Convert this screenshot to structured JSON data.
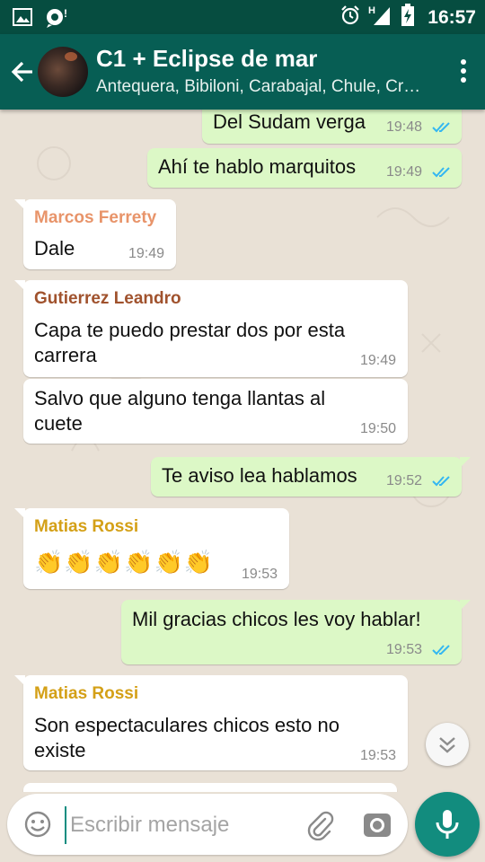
{
  "status_bar": {
    "time": "16:57",
    "icons": [
      "gallery-icon",
      "notification-icon",
      "alarm-icon",
      "signal-icon",
      "battery-charging-icon"
    ],
    "network_label": "H"
  },
  "header": {
    "group_name": "C1 + Eclipse de mar",
    "members": "Antequera, Bibiloni, Carabajal, Chule, Cr…",
    "colors": {
      "header_bg": "#075e54",
      "status_bg": "#064d40"
    }
  },
  "messages": [
    {
      "direction": "out",
      "text": "Del Sudam verga",
      "time": "19:48",
      "status": "read"
    },
    {
      "direction": "out",
      "text": "Ahí te hablo marquitos",
      "time": "19:49",
      "status": "read"
    },
    {
      "direction": "in",
      "sender": "Marcos Ferrety",
      "sender_color": "#e8946a",
      "text": "Dale",
      "time": "19:49"
    },
    {
      "direction": "in",
      "sender": "Gutierrez Leandro",
      "sender_color": "#a0522d",
      "lines": [
        "Capa te puedo prestar dos por esta",
        "carrera"
      ],
      "time": "19:49"
    },
    {
      "direction": "in",
      "lines": [
        "Salvo que alguno tenga llantas al",
        "cuete"
      ],
      "time": "19:50"
    },
    {
      "direction": "out",
      "text": "Te aviso lea hablamos",
      "time": "19:52",
      "status": "read"
    },
    {
      "direction": "in",
      "sender": "Matias Rossi",
      "sender_color": "#d4a017",
      "text": "👏👏👏👏👏👏",
      "time": "19:53"
    },
    {
      "direction": "out",
      "text": "Mil gracias chicos les voy hablar!",
      "time": "19:53",
      "status": "read"
    },
    {
      "direction": "in",
      "sender": "Matias Rossi",
      "sender_color": "#d4a017",
      "lines": [
        "Son espectaculares chicos esto no",
        "existe"
      ],
      "time": "19:53"
    }
  ],
  "composer": {
    "placeholder": "Escribir mensaje"
  }
}
